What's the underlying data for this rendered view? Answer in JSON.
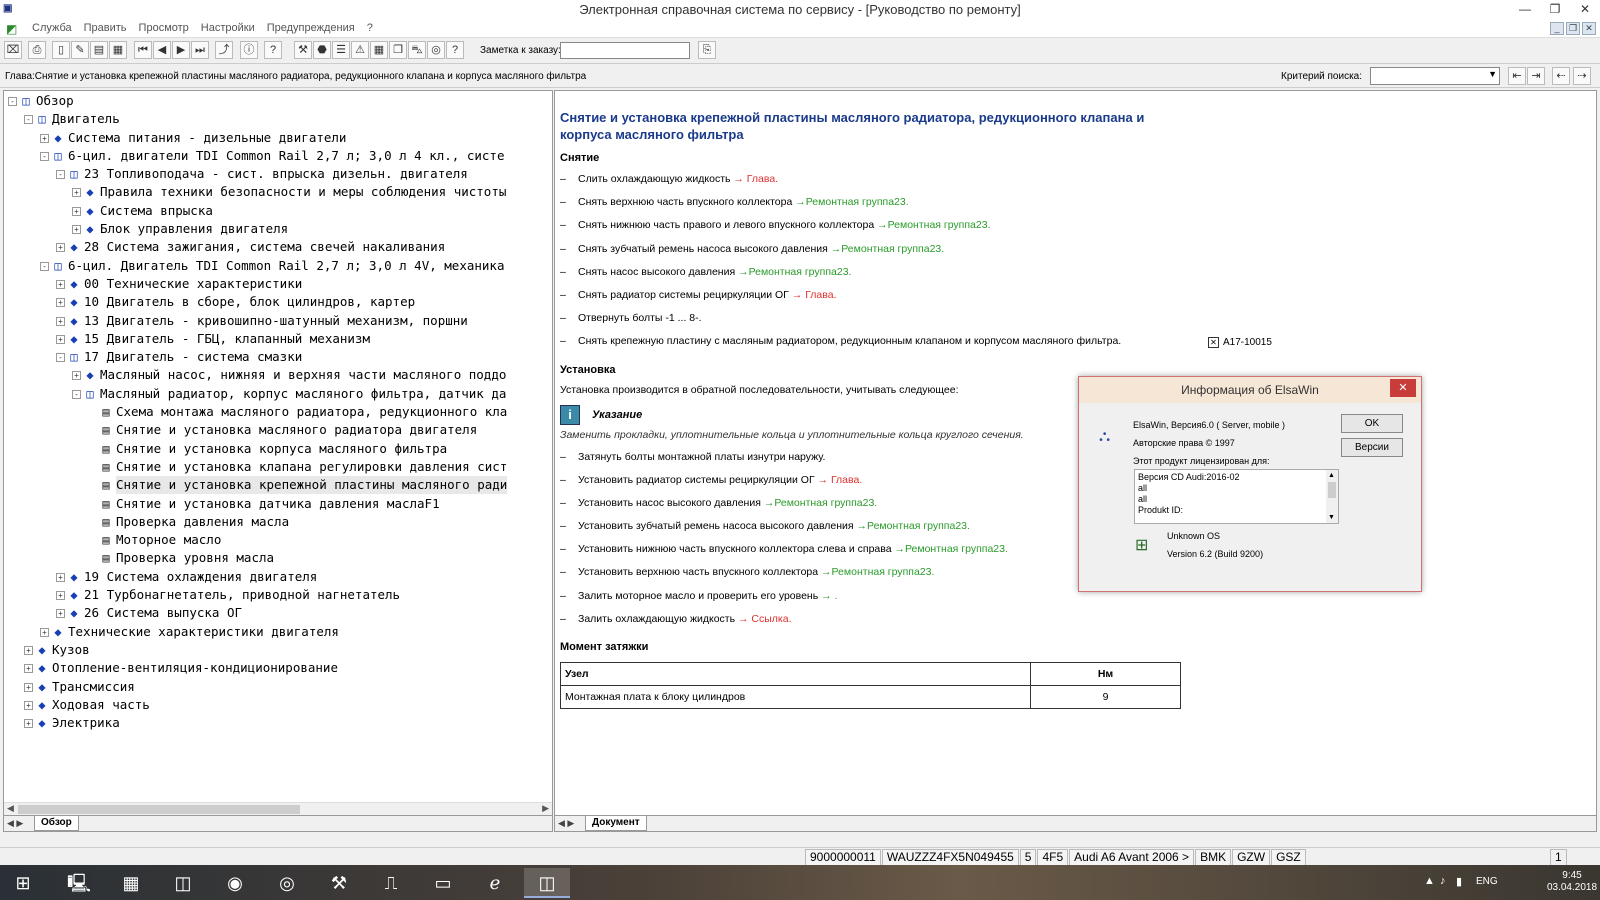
{
  "window": {
    "title": "Электронная справочная система по сервису - [Руководство по ремонту]",
    "app_icon": "elsawin-app-icon",
    "controls": [
      "minimize",
      "restore",
      "close"
    ]
  },
  "menu": {
    "items": [
      "Служба",
      "Править",
      "Просмотр",
      "Настройки",
      "Предупреждения",
      "?"
    ]
  },
  "toolbar": {
    "buttons": [
      "exit-icon",
      "print-icon",
      "new-doc-icon",
      "edit-doc-icon",
      "print-preview-icon",
      "print-setup-icon",
      "first-icon",
      "prev-icon",
      "next-icon",
      "last-icon",
      "up-level-icon",
      "info-icon",
      "help-icon",
      "tools-icon",
      "stop-icon",
      "list-icon",
      "warning-icon",
      "calculator-icon",
      "book-icon",
      "car-icon",
      "globe-icon",
      "question-icon"
    ],
    "order_note_label": "Заметка к заказу:",
    "order_note_value": "",
    "order_note_button_icon": "note-button-icon"
  },
  "chapter": {
    "text": "Глава:Снятие и установка крепежной пластины масляного радиатора, редукционного клапана и корпуса масляного фильтра",
    "search_label": "Критерий поиска:",
    "search_value": ""
  },
  "tree": {
    "nodes": [
      {
        "label": "Обзор",
        "level": 0,
        "expand": "-",
        "icon": "open"
      },
      {
        "label": "Двигатель",
        "level": 1,
        "expand": "-",
        "icon": "open"
      },
      {
        "label": "Система питания - дизельные двигатели",
        "level": 2,
        "expand": "+",
        "icon": "book"
      },
      {
        "label": "6-цил. двигатели TDI Common Rail 2,7 л; 3,0 л 4 кл., систе",
        "level": 2,
        "expand": "-",
        "icon": "open"
      },
      {
        "label": "23 Топливоподача - сист. впрыска дизельн. двигателя",
        "level": 3,
        "expand": "-",
        "icon": "open"
      },
      {
        "label": "Правила техники безопасности и меры соблюдения чистоты",
        "level": 4,
        "expand": "+",
        "icon": "book"
      },
      {
        "label": "Система впрыска",
        "level": 4,
        "expand": "+",
        "icon": "book"
      },
      {
        "label": "Блок управления двигателя",
        "level": 4,
        "expand": "+",
        "icon": "book"
      },
      {
        "label": "28 Система зажигания, система свечей накаливания",
        "level": 3,
        "expand": "+",
        "icon": "book"
      },
      {
        "label": "6-цил. Двигатель TDI Common Rail 2,7 л; 3,0 л 4V, механика",
        "level": 2,
        "expand": "-",
        "icon": "open"
      },
      {
        "label": "00 Технические характеристики",
        "level": 3,
        "expand": "+",
        "icon": "book"
      },
      {
        "label": "10 Двигатель в сборе, блок цилиндров, картер",
        "level": 3,
        "expand": "+",
        "icon": "book"
      },
      {
        "label": "13 Двигатель - кривошипно-шатунный механизм, поршни",
        "level": 3,
        "expand": "+",
        "icon": "book"
      },
      {
        "label": "15 Двигатель - ГБЦ, клапанный механизм",
        "level": 3,
        "expand": "+",
        "icon": "book"
      },
      {
        "label": "17 Двигатель - система смазки",
        "level": 3,
        "expand": "-",
        "icon": "open"
      },
      {
        "label": "Масляный насос, нижняя и верхняя части масляного поддо",
        "level": 4,
        "expand": "+",
        "icon": "book"
      },
      {
        "label": "Масляный радиатор, корпус масляного фильтра, датчик да",
        "level": 4,
        "expand": "-",
        "icon": "open"
      },
      {
        "label": "Схема монтажа масляного радиатора, редукционного кла",
        "level": 5,
        "expand": "",
        "icon": "doc"
      },
      {
        "label": "Снятие и установка масляного радиатора двигателя",
        "level": 5,
        "expand": "",
        "icon": "doc"
      },
      {
        "label": "Снятие и установка корпуса масляного фильтра",
        "level": 5,
        "expand": "",
        "icon": "doc"
      },
      {
        "label": "Снятие и установка клапана регулировки давления сист",
        "level": 5,
        "expand": "",
        "icon": "doc"
      },
      {
        "label": "Снятие и установка крепежной пластины масляного ради",
        "level": 5,
        "expand": "",
        "icon": "doc",
        "selected": true
      },
      {
        "label": "Снятие и установка датчика давления маслаF1",
        "level": 5,
        "expand": "",
        "icon": "doc"
      },
      {
        "label": "Проверка давления масла",
        "level": 5,
        "expand": "",
        "icon": "doc"
      },
      {
        "label": "Моторное масло",
        "level": 5,
        "expand": "",
        "icon": "doc"
      },
      {
        "label": "Проверка уровня масла",
        "level": 5,
        "expand": "",
        "icon": "doc"
      },
      {
        "label": "19 Система охлаждения двигателя",
        "level": 3,
        "expand": "+",
        "icon": "book"
      },
      {
        "label": "21 Турбонагнетатель, приводной нагнетатель",
        "level": 3,
        "expand": "+",
        "icon": "book"
      },
      {
        "label": "26 Система выпуска ОГ",
        "level": 3,
        "expand": "+",
        "icon": "book"
      },
      {
        "label": "Технические характеристики двигателя",
        "level": 2,
        "expand": "+",
        "icon": "book"
      },
      {
        "label": "Кузов",
        "level": 1,
        "expand": "+",
        "icon": "book"
      },
      {
        "label": "Отопление-вентиляция-кондиционирование",
        "level": 1,
        "expand": "+",
        "icon": "book"
      },
      {
        "label": "Трансмиссия",
        "level": 1,
        "expand": "+",
        "icon": "book"
      },
      {
        "label": "Ходовая часть",
        "level": 1,
        "expand": "+",
        "icon": "book"
      },
      {
        "label": "Электрика",
        "level": 1,
        "expand": "+",
        "icon": "book"
      }
    ],
    "tab_label": "Обзор"
  },
  "document": {
    "title": "Снятие и установка крепежной пластины масляного радиатора, редукционного клапана и корпуса масляного фильтра",
    "removal_heading": "Снятие",
    "removal_steps": [
      {
        "text": "Слить охлаждающую жидкость ",
        "link": "→ Глава.",
        "link_color": "red"
      },
      {
        "text": "Снять верхнюю часть впускного коллектора ",
        "link": "→Ремонтная группа23.",
        "link_color": "green"
      },
      {
        "text": "Снять нижнюю часть правого и левого впускного коллектора ",
        "link": "→Ремонтная группа23.",
        "link_color": "green"
      },
      {
        "text": "Снять зубчатый ремень насоса высокого давления ",
        "link": "→Ремонтная группа23.",
        "link_color": "green"
      },
      {
        "text": "Снять насос высокого давления ",
        "link": "→Ремонтная группа23.",
        "link_color": "green"
      },
      {
        "text": "Снять радиатор системы рециркуляции ОГ ",
        "link": "→ Глава.",
        "link_color": "red"
      },
      {
        "text": "Отвернуть болты -1 ... 8-.",
        "link": "",
        "link_color": ""
      },
      {
        "text": "Снять крепежную пластину с масляным радиатором, редукционным клапаном и корпусом масляного фильтра.",
        "link": "",
        "link_color": ""
      }
    ],
    "figure_label": "A17-10015",
    "install_heading": "Установка",
    "install_intro": "Установка производится в обратной последовательности, учитывать следующее:",
    "note_title": "Указание",
    "note_text": "Заменить прокладки, уплотнительные кольца и уплотнительные кольца круглого сечения.",
    "install_steps": [
      {
        "text": "Затянуть болты монтажной платы изнутри наружу.",
        "link": "",
        "link_color": ""
      },
      {
        "text": "Установить радиатор системы рециркуляции ОГ ",
        "link": "→ Глава.",
        "link_color": "red"
      },
      {
        "text": "Установить насос высокого давления ",
        "link": "→Ремонтная группа23.",
        "link_color": "green"
      },
      {
        "text": "Установить зубчатый ремень насоса высокого давления ",
        "link": "→Ремонтная группа23.",
        "link_color": "green"
      },
      {
        "text": "Установить нижнюю часть впускного коллектора слева и справа ",
        "link": "→Ремонтная группа23.",
        "link_color": "green"
      },
      {
        "text": "Установить верхнюю часть впускного коллектора ",
        "link": "→Ремонтная группа23.",
        "link_color": "green"
      },
      {
        "text": "Залить моторное масло и проверить его уровень ",
        "link": "→ .",
        "link_color": "green"
      },
      {
        "text": "Залить охлаждающую жидкость ",
        "link": "→ Ссылка.",
        "link_color": "red"
      }
    ],
    "torque_heading": "Момент затяжки",
    "torque_table": {
      "headers": [
        "Узел",
        "Нм"
      ],
      "rows": [
        [
          "Монтажная плата к блоку цилиндров",
          "9"
        ]
      ]
    },
    "tab_label": "Документ"
  },
  "dialog": {
    "title": "Информация об  ElsaWin",
    "version": "ElsaWin, Версия6.0 ( Server, mobile )",
    "copyright": "Авторские права © 1997",
    "licensed_label": "Этот продукт лицензирован для:",
    "license_lines": [
      "Версия CD  Audi:2016-02",
      "all",
      "all",
      "Produkt ID:"
    ],
    "ok_label": "OK",
    "versions_label": "Версии",
    "os_name": "Unknown OS",
    "os_version": "Version 6.2 (Build 9200)"
  },
  "status": {
    "cells": [
      "9000000011",
      "WAUZZZ4FX5N049455",
      "5",
      "4F5",
      "Audi A6 Avant 2006 >",
      "BMK",
      "GZW",
      "GSZ"
    ],
    "page": "1"
  },
  "taskbar": {
    "apps": [
      "windows-start-icon",
      "computer-icon",
      "calculator-icon",
      "elsa-icon",
      "firefox-icon",
      "chrome-icon",
      "tool-icon",
      "vag-icon",
      "folder-icon",
      "ie-icon",
      "elsawin-icon"
    ],
    "lang": "ENG",
    "time": "9:45",
    "date": "03.04.2018"
  },
  "colors": {
    "link_red": "#e03030",
    "link_green": "#2a9a2a",
    "doc_title": "#1a3a8a",
    "tree_icon": "#1a3fb3",
    "dialog_close": "#c83c3c"
  }
}
